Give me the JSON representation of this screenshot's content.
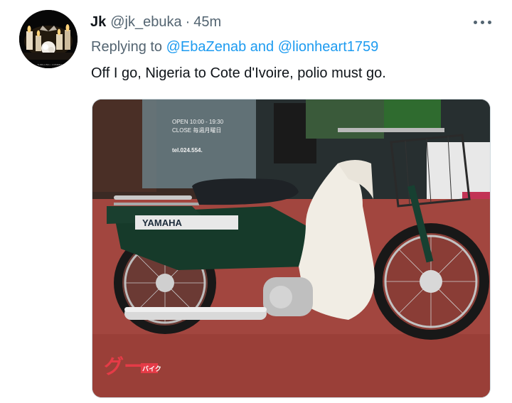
{
  "tweet": {
    "display_name": "Jk",
    "handle": "@jk_ebuka",
    "separator": "·",
    "time": "45m",
    "replying_prefix": "Replying to",
    "mention_1": "@EbaZenab",
    "conjunction": "and",
    "mention_2": "@lionheart1759",
    "text": "Off I go, Nigeria to Cote d'Ivoire, polio must go."
  },
  "avatar": {
    "caption": "THRILLING • COMEDY"
  },
  "media": {
    "brand_text": "YAMAHA",
    "sign_line_1": "OPEN 10:00 - 19:30",
    "sign_line_2": "CLOSE 毎週月曜日",
    "sign_line_3": "tel.024.554.",
    "watermark_main": "グー",
    "watermark_badge": "バイク"
  },
  "colors": {
    "link": "#1d9bf0",
    "secondary_text": "#536471",
    "primary_text": "#0f1419",
    "border": "#cfd9de"
  },
  "icons": {
    "more": "more-dots-icon"
  }
}
